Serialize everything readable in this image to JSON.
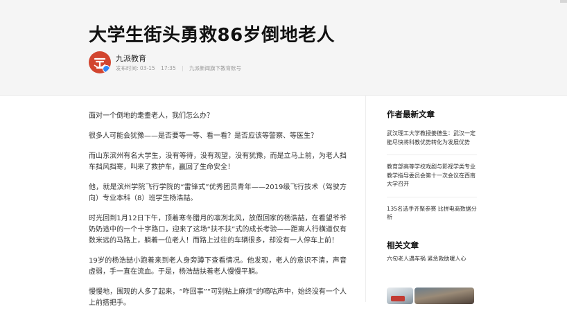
{
  "article": {
    "title": "大学生街头勇救86岁倒地老人",
    "author": {
      "name": "九派教育",
      "publish_date": "发布时间: 03-15",
      "publish_time": "17:35",
      "source": "九派新闻旗下教育账号",
      "avatar_icon": "brand-logo-icon",
      "avatar_color": "#d2452f",
      "verified_icon": "verified-badge-icon"
    },
    "paragraphs": [
      "面对一个倒地的耄耋老人，我们怎么办？",
      "很多人可能会犹豫——是否要等一等、看一看？是否应该等警察、等医生？",
      "而山东滨州有名大学生，没有等待，没有观望，没有犹豫，而是立马上前，为老人挡车挡风挡寒，叫来了救护车，赢回了生命安全！",
      "他，就是滨州学院飞行学院的“雷锋式”优秀团员青年——2019级飞行技术（驾驶方向）专业本科（8）班学生杨浩喆。",
      "时光回到1月12日下午，顶着寒冬腊月的凛冽北风，放假回家的杨浩喆，在看望爷爷奶奶途中的一个十字路口，迎来了这场“扶不扶”式的成长考验——距离人行横道仅有数米远的马路上，躺着一位老人！而路上过往的车辆很多，却没有一人停车上前！",
      "19岁的杨浩喆小跑着来到老人身旁蹲下查看情况。他发现，老人的意识不清，声音虚弱，手一直在流血。于是，杨浩喆扶着老人慢慢平躺。",
      "慢慢地，围观的人多了起来，“咋回事”“可别粘上麻烦”的嘀咕声中，始终没有一个人上前搭把手。"
    ]
  },
  "sidebar": {
    "latest_heading": "作者最新文章",
    "latest_items": [
      "武汉理工大学教授姜德生：武汉一定能尽快将科教优势转化为发展优势",
      "教育部高等学校戏剧与影视学类专业教学指导委员会第十一次会议在西南大学召开",
      "135名选手齐聚参赛 比拼电商数据分析"
    ],
    "related_heading": "相关文章",
    "related_items": [
      "六旬老人遇车祸 紧急救助暖人心"
    ]
  }
}
